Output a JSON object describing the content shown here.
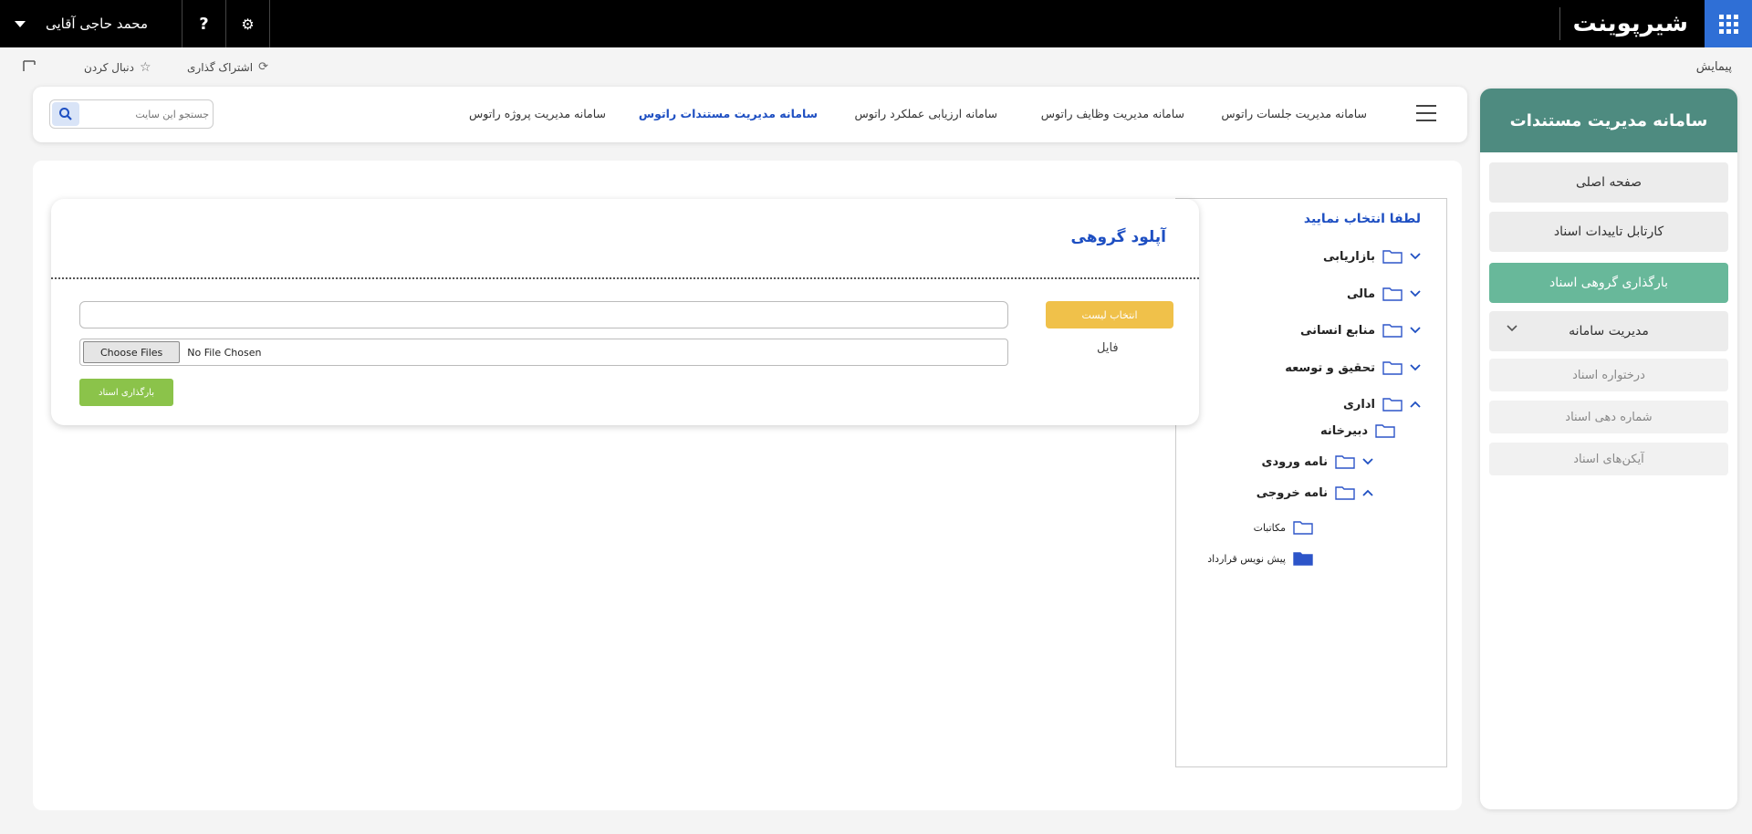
{
  "suite": {
    "brand": "شیرپوینت",
    "user_name": "محمد حاجی آقایی",
    "help_label": "?",
    "settings_glyph": "⚙"
  },
  "ribbon": {
    "nav_label": "پیمایش",
    "share": "اشتراک گذاری",
    "follow": "دنبال کردن"
  },
  "topnav": {
    "links": [
      "سامانه مدیریت جلسات راتوس",
      "سامانه مدیریت وظایف راتوس",
      "سامانه ارزیابی عملکرد راتوس",
      "سامانه مدیریت مستندات راتوس",
      "سامانه مدیریت پروژه راتوس"
    ],
    "search_placeholder": "جستجو این سایت"
  },
  "sidebar": {
    "title": "سامانه مدیریت مستندات",
    "items": [
      {
        "label": "صفحه اصلی"
      },
      {
        "label": "کارتابل تاییدات اسناد"
      },
      {
        "label": "بارگذاری گروهی اسناد",
        "active": true
      },
      {
        "label": "مدیریت سامانه",
        "expandable": true
      }
    ],
    "sub_items": [
      {
        "label": "درختواره اسناد"
      },
      {
        "label": "شماره دهی اسناد"
      },
      {
        "label": "آیکن‌های اسناد"
      }
    ]
  },
  "tree": {
    "title": "لطفا انتخاب نمایید",
    "nodes": [
      {
        "label": "بازاریابی",
        "expander": "collapsed"
      },
      {
        "label": "مالی",
        "expander": "collapsed"
      },
      {
        "label": "منابع انسانی",
        "expander": "collapsed"
      },
      {
        "label": "تحقیق و توسعه",
        "expander": "collapsed"
      },
      {
        "label": "اداری",
        "expander": "expanded"
      },
      {
        "label": "دبیرخانه",
        "expander": "none"
      },
      {
        "label": "نامه ورودی",
        "expander": "collapsed"
      },
      {
        "label": "نامه خروجی",
        "expander": "expanded"
      },
      {
        "label": "مکاتبات",
        "expander": "none"
      },
      {
        "label": "پیش نویس قرارداد",
        "expander": "none",
        "selected": true
      }
    ]
  },
  "upload": {
    "title": "آپلود گروهی",
    "select_list_button": "انتخاب لیست",
    "list_value": "",
    "file_label": "فایل",
    "choose_files": "Choose Files",
    "no_file": "No File Chosen",
    "upload_button": "بارگذاری اسناد"
  },
  "colors": {
    "accent_blue": "#1e4fc2",
    "sidebar_header": "#4e8b80",
    "active_item": "#68b89a",
    "select_button": "#f0c14a",
    "upload_button": "#8bc34a",
    "waffle": "#2f6fd6"
  }
}
